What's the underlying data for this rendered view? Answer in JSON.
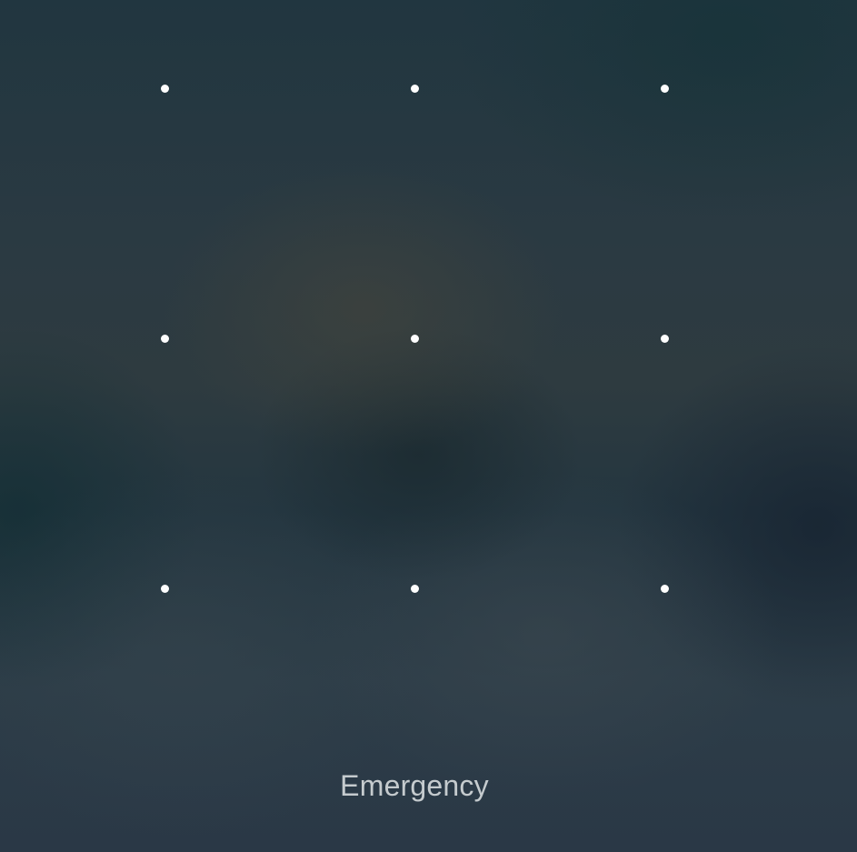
{
  "pattern_lock": {
    "rows": 3,
    "columns": 3,
    "dot_color": "#ffffff"
  },
  "emergency": {
    "label": "Emergency",
    "color": "#c5cbce"
  }
}
